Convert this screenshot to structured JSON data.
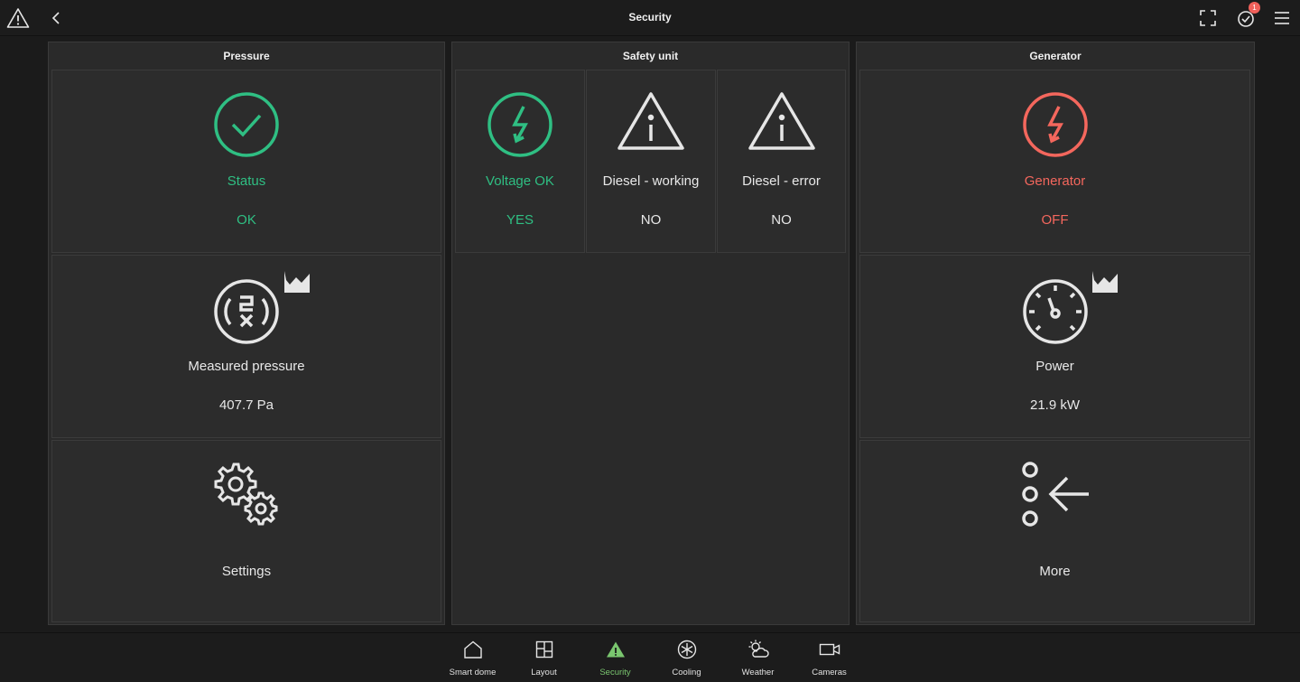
{
  "header": {
    "title": "Security",
    "notification_count": "1",
    "icons": [
      "warning-icon",
      "back-chevron-icon",
      "fullscreen-icon",
      "alarm-check-icon",
      "menu-icon"
    ]
  },
  "colors": {
    "ok_green": "#2fbf83",
    "alert_red": "#f4675d",
    "nav_active": "#7ac66f",
    "badge_red": "#f0605a"
  },
  "panels": {
    "pressure": {
      "title": "Pressure",
      "status": {
        "label": "Status",
        "value": "OK",
        "icon": "check-circle-icon"
      },
      "measured": {
        "label": "Measured pressure",
        "value": "407.7 Pa",
        "icon": "pressure-gauge-icon"
      },
      "settings": {
        "label": "Settings",
        "icon": "gears-icon"
      }
    },
    "safety": {
      "title": "Safety unit",
      "voltage": {
        "label": "Voltage OK",
        "value": "YES",
        "icon": "lightning-circle-icon"
      },
      "diesel_working": {
        "label": "Diesel - working",
        "value": "NO",
        "icon": "warning-info-icon"
      },
      "diesel_error": {
        "label": "Diesel - error",
        "value": "NO",
        "icon": "warning-info-icon"
      }
    },
    "generator": {
      "title": "Generator",
      "generator": {
        "label": "Generator",
        "value": "OFF",
        "icon": "lightning-circle-icon"
      },
      "power": {
        "label": "Power",
        "value": "21.9 kW",
        "icon": "speedometer-icon"
      },
      "more": {
        "label": "More",
        "icon": "more-arrow-icon"
      }
    }
  },
  "nav": [
    {
      "label": "Smart dome",
      "icon": "home-icon"
    },
    {
      "label": "Layout",
      "icon": "layout-icon"
    },
    {
      "label": "Security",
      "icon": "warning-triangle-icon",
      "active": true
    },
    {
      "label": "Cooling",
      "icon": "snowflake-icon"
    },
    {
      "label": "Weather",
      "icon": "weather-icon"
    },
    {
      "label": "Cameras",
      "icon": "camera-icon"
    }
  ]
}
